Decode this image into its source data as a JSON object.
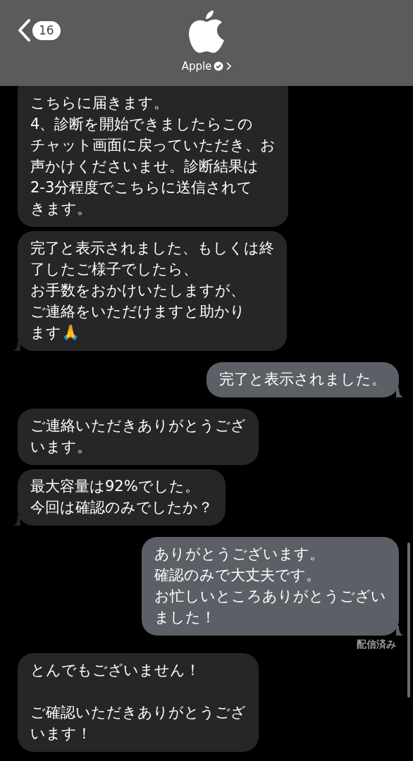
{
  "header": {
    "back_count": "16",
    "contact_name": "Apple"
  },
  "messages": [
    {
      "kind": "received",
      "paragraphs": [
        [
          "こちらに届きます。",
          "4、診断を開始できましたらこの",
          "チャット画面に戻っていただき、お",
          "声かけくださいませ。診断結果は",
          "2-3分程度でこちらに送信されて",
          "きます。"
        ]
      ],
      "tail": false
    },
    {
      "kind": "received",
      "paragraphs": [
        [
          "完了と表示されました、もしくは終",
          "了したご様子でしたら、",
          "お手数をおかけいたしますが、",
          "ご連絡をいただけますと助かり",
          "ます🙏"
        ]
      ],
      "tail": true
    },
    {
      "kind": "sent",
      "paragraphs": [
        [
          "完了と表示されました。"
        ]
      ],
      "tail": true
    },
    {
      "kind": "received",
      "paragraphs": [
        [
          "ご連絡いただきありがとうござ",
          "います。"
        ]
      ],
      "tail": false
    },
    {
      "kind": "received",
      "paragraphs": [
        [
          "最大容量は92%でした。",
          "今回は確認のみでしたか？"
        ]
      ],
      "tail": true
    },
    {
      "kind": "sent",
      "paragraphs": [
        [
          "ありがとうございます。",
          "確認のみで大丈夫です。",
          "お忙しいところありがとうござい",
          "ました！"
        ]
      ],
      "tail": true
    },
    {
      "kind": "status",
      "text": "配信済み"
    },
    {
      "kind": "received",
      "paragraphs": [
        [
          "とんでもございません！"
        ],
        [
          "ご確認いただきありがとうござ",
          "います！"
        ]
      ]
    }
  ]
}
